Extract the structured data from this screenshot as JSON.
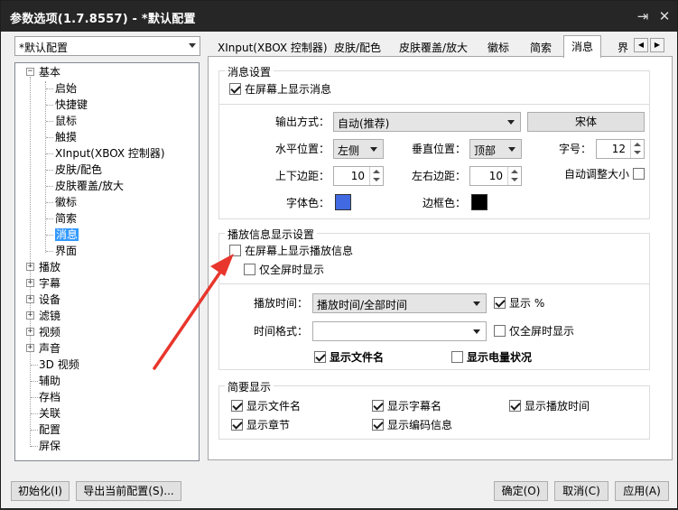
{
  "window": {
    "title": "参数选项(1.7.8557) - *默认配置",
    "pin_glyph": "⇥",
    "close_glyph": "✕"
  },
  "profile_combo": {
    "value": "*默认配置"
  },
  "tree": {
    "root_expanded_glyph": "−",
    "collapsed_glyph": "+",
    "basic": "基本",
    "basic_children": [
      "启始",
      "快捷键",
      "鼠标",
      "触摸",
      "XInput(XBOX 控制器)",
      "皮肤/配色",
      "皮肤覆盖/放大",
      "徽标",
      "简索",
      "消息",
      "界面"
    ],
    "selected": "消息",
    "expandable": [
      "播放",
      "字幕",
      "设备",
      "滤镜",
      "视频",
      "声音"
    ],
    "leaf": [
      "3D 视频",
      "辅助",
      "存档",
      "关联",
      "配置",
      "屏保"
    ]
  },
  "tabs": [
    "XInput(XBOX 控制器)",
    "皮肤/配色",
    "皮肤覆盖/放大",
    "徽标",
    "简索",
    "消息",
    "界"
  ],
  "tab_scroll": {
    "left": "◀",
    "right": "▶"
  },
  "msg_group": {
    "title": "消息设置",
    "show_on_screen": {
      "label": "在屏幕上显示消息",
      "checked": true
    },
    "output_label": "输出方式：",
    "output_value": "自动(推荐)",
    "font_button": "宋体",
    "hpos_label": "水平位置：",
    "hpos_value": "左侧",
    "vpos_label": "垂直位置：",
    "vpos_value": "顶部",
    "fontsize_label": "字号：",
    "fontsize_value": "12",
    "tb_margin_label": "上下边距：",
    "tb_margin_value": "10",
    "lr_margin_label": "左右边距：",
    "lr_margin_value": "10",
    "auto_size": {
      "label": "自动调整大小",
      "checked": false
    },
    "font_color_label": "字体色：",
    "font_color": "#4169e1",
    "border_color_label": "边框色：",
    "border_color": "#000000"
  },
  "play_group": {
    "title": "播放信息显示设置",
    "show_play_info": {
      "label": "在屏幕上显示播放信息",
      "checked": false
    },
    "fullscreen_only": {
      "label": "仅全屏时显示",
      "checked": false
    },
    "play_time_label": "播放时间：",
    "play_time_value": "播放时间/全部时间",
    "show_percent": {
      "label": "显示 %",
      "checked": true
    },
    "time_format_label": "时间格式：",
    "time_format_value": "",
    "fullscreen_only_2": {
      "label": "仅全屏时显示",
      "checked": false
    },
    "show_filename": {
      "label": "显示文件名",
      "checked": true
    },
    "show_battery": {
      "label": "显示电量状况",
      "checked": false
    }
  },
  "brief_group": {
    "title": "简要显示",
    "items": [
      {
        "label": "显示文件名",
        "checked": true
      },
      {
        "label": "显示字幕名",
        "checked": true
      },
      {
        "label": "显示播放时间",
        "checked": true
      },
      {
        "label": "显示章节",
        "checked": true
      },
      {
        "label": "显示编码信息",
        "checked": true
      }
    ]
  },
  "footer": {
    "init": "初始化(I)",
    "export": "导出当前配置(S)...",
    "ok": "确定(O)",
    "cancel": "取消(C)",
    "apply": "应用(A)"
  },
  "annotation": {
    "arrow_color": "#e8362c"
  }
}
